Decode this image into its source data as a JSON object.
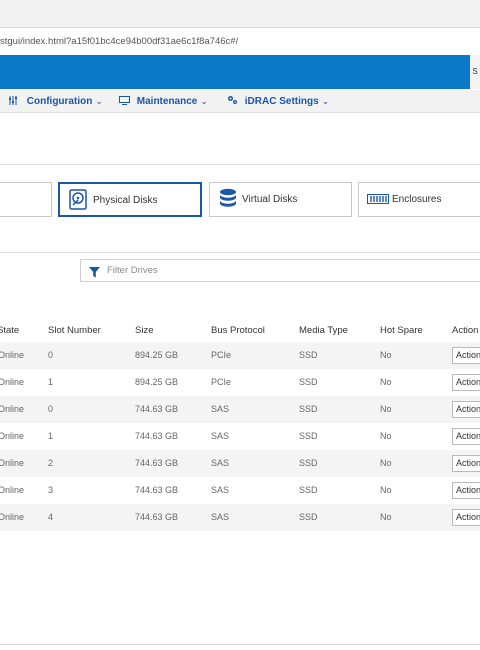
{
  "browser": {
    "url": "stgui/index.html?a15f01bc4ce94b00df31ae6c1f8a746c#/"
  },
  "brandbar": {
    "edge_text": "S"
  },
  "nav": [
    {
      "label": "Configuration",
      "icon": "sliders-icon"
    },
    {
      "label": "Maintenance",
      "icon": "monitor-icon"
    },
    {
      "label": "iDRAC Settings",
      "icon": "gears-icon"
    }
  ],
  "tabs": [
    {
      "label": "Physical Disks",
      "icon": "physical-disk-icon",
      "active": true
    },
    {
      "label": "Virtual Disks",
      "icon": "virtual-disk-icon",
      "active": false
    },
    {
      "label": "Enclosures",
      "icon": "enclosure-icon",
      "active": false
    }
  ],
  "filter": {
    "placeholder": "Filter Drives"
  },
  "table": {
    "headers": [
      "State",
      "Slot Number",
      "Size",
      "Bus Protocol",
      "Media Type",
      "Hot Spare",
      "Action"
    ],
    "rows": [
      {
        "state": "Online",
        "slot": "0",
        "size": "894.25 GB",
        "bus": "PCIe",
        "media": "SSD",
        "hot_spare": "No",
        "action": "Actions"
      },
      {
        "state": "Online",
        "slot": "1",
        "size": "894.25 GB",
        "bus": "PCIe",
        "media": "SSD",
        "hot_spare": "No",
        "action": "Actions"
      },
      {
        "state": "Online",
        "slot": "0",
        "size": "744.63 GB",
        "bus": "SAS",
        "media": "SSD",
        "hot_spare": "No",
        "action": "Actions"
      },
      {
        "state": "Online",
        "slot": "1",
        "size": "744.63 GB",
        "bus": "SAS",
        "media": "SSD",
        "hot_spare": "No",
        "action": "Actions"
      },
      {
        "state": "Online",
        "slot": "2",
        "size": "744.63 GB",
        "bus": "SAS",
        "media": "SSD",
        "hot_spare": "No",
        "action": "Actions"
      },
      {
        "state": "Online",
        "slot": "3",
        "size": "744.63 GB",
        "bus": "SAS",
        "media": "SSD",
        "hot_spare": "No",
        "action": "Actions"
      },
      {
        "state": "Online",
        "slot": "4",
        "size": "744.63 GB",
        "bus": "SAS",
        "media": "SSD",
        "hot_spare": "No",
        "action": "Actions"
      }
    ]
  },
  "colors": {
    "brand": "#0a78c8",
    "nav_text": "#1a57a7",
    "row_alt": "#f4f4f4"
  }
}
